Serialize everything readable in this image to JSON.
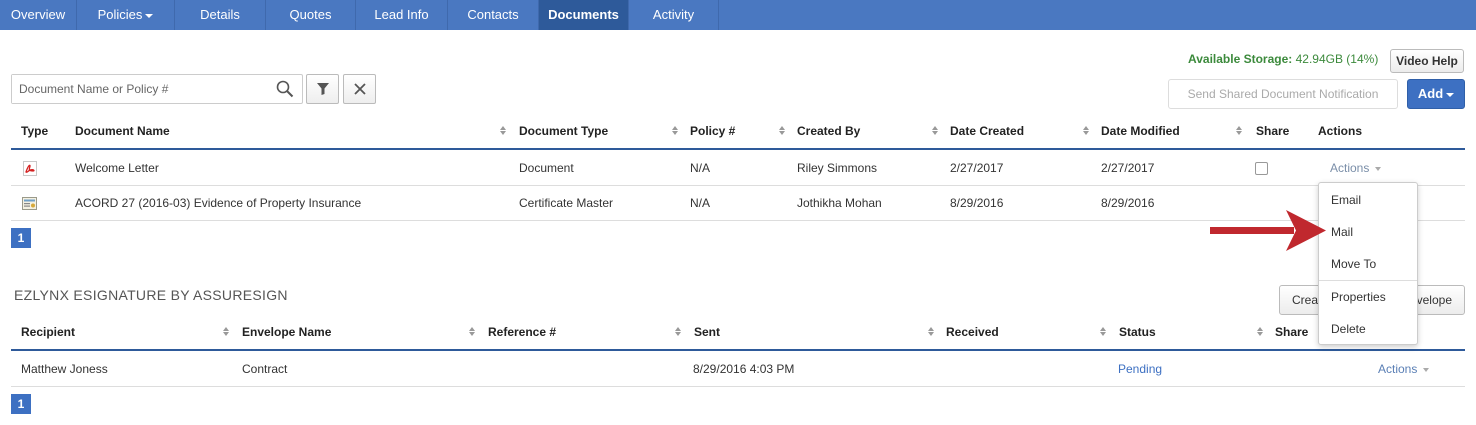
{
  "nav": {
    "tabs": [
      {
        "label": "Overview"
      },
      {
        "label": "Policies"
      },
      {
        "label": "Details"
      },
      {
        "label": "Quotes"
      },
      {
        "label": "Lead Info"
      },
      {
        "label": "Contacts"
      },
      {
        "label": "Documents"
      },
      {
        "label": "Activity"
      }
    ]
  },
  "storage": {
    "label": "Available Storage:",
    "value": "42.94GB (14%)"
  },
  "toolbar": {
    "video_help": "Video Help",
    "send_shared": "Send Shared Document Notification",
    "add": "Add"
  },
  "search": {
    "placeholder": "Document Name or Policy #"
  },
  "documents": {
    "columns": [
      "Type",
      "Document Name",
      "Document Type",
      "Policy #",
      "Created By",
      "Date Created",
      "Date Modified",
      "Share",
      "Actions"
    ],
    "rows": [
      {
        "type_icon": "pdf-icon",
        "name": "Welcome Letter",
        "doc_type": "Document",
        "policy": "N/A",
        "created_by": "Riley Simmons",
        "created": "2/27/2017",
        "modified": "2/27/2017",
        "actions": "Actions"
      },
      {
        "type_icon": "certificate-icon",
        "name": "ACORD 27 (2016-03) Evidence of Property Insurance",
        "doc_type": "Certificate Master",
        "policy": "N/A",
        "created_by": "Jothikha Mohan",
        "created": "8/29/2016",
        "modified": "8/29/2016"
      }
    ],
    "page": "1"
  },
  "actions_menu": {
    "items": [
      "Email",
      "Mail",
      "Move To",
      "Properties",
      "Delete"
    ]
  },
  "esignature": {
    "title": "EZLYNX ESIGNATURE BY ASSURESIGN",
    "create_button": "Crea",
    "create_button_tail": "velope",
    "columns": [
      "Recipient",
      "Envelope Name",
      "Reference #",
      "Sent",
      "Received",
      "Status",
      "Share"
    ],
    "rows": [
      {
        "recipient": "Matthew Joness",
        "envelope": "Contract",
        "reference": "",
        "sent": "8/29/2016 4:03 PM",
        "received": "",
        "status": "Pending",
        "actions": "Actions"
      }
    ],
    "page": "1"
  },
  "colors": {
    "nav": "#4a78c1",
    "nav_active": "#2e5a9a",
    "accent": "#3d70c2",
    "storage": "#3c8a3c",
    "arrow": "#c0282e"
  }
}
